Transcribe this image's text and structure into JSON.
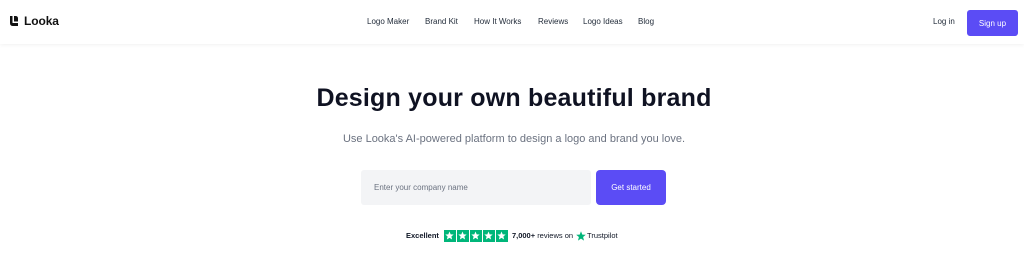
{
  "header": {
    "logo_text": "Looka",
    "nav": [
      {
        "label": "Logo Maker"
      },
      {
        "label": "Brand Kit"
      },
      {
        "label": "How It Works"
      },
      {
        "label": "Reviews"
      },
      {
        "label": "Logo Ideas"
      },
      {
        "label": "Blog"
      }
    ],
    "login_label": "Log in",
    "signup_label": "Sign up"
  },
  "hero": {
    "title": "Design your own beautiful brand",
    "subtitle": "Use Looka's AI-powered platform to design a logo and brand you love.",
    "input_placeholder": "Enter your company name",
    "input_value": "",
    "cta_label": "Get started"
  },
  "trust": {
    "rating_label": "Excellent",
    "stars": 5,
    "reviews_count": "7,000+",
    "reviews_text": "reviews on",
    "provider": "Trustpilot"
  },
  "colors": {
    "brand": "#5b4cf5",
    "trustpilot_green": "#00b67a",
    "title": "#0f1222",
    "subtitle": "#6b7280"
  },
  "icons": {
    "logo": "looka-logo-icon",
    "star": "star-icon",
    "trustpilot": "trustpilot-star-icon"
  }
}
